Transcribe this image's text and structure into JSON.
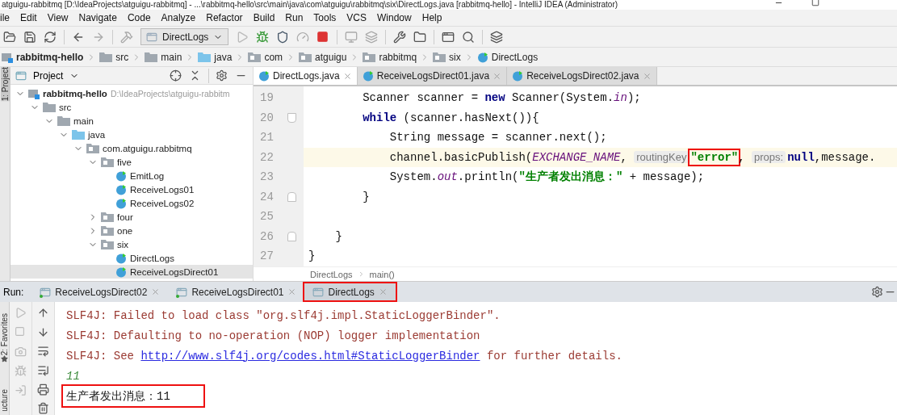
{
  "window": {
    "title": "atguigu-rabbitmq [D:\\IdeaProjects\\atguigu-rabbitmq] - ...\\rabbitmq-hello\\src\\main\\java\\com\\atguigu\\rabbitmq\\six\\DirectLogs.java [rabbitmq-hello] - IntelliJ IDEA (Administrator)"
  },
  "menu": [
    "ile",
    "Edit",
    "View",
    "Navigate",
    "Code",
    "Analyze",
    "Refactor",
    "Build",
    "Run",
    "Tools",
    "VCS",
    "Window",
    "Help"
  ],
  "toolbar": {
    "run_config": "DirectLogs"
  },
  "breadcrumb": [
    {
      "label": "rabbitmq-hello",
      "kind": "module"
    },
    {
      "label": "src",
      "kind": "folder"
    },
    {
      "label": "main",
      "kind": "folder"
    },
    {
      "label": "java",
      "kind": "source-folder"
    },
    {
      "label": "com",
      "kind": "package"
    },
    {
      "label": "atguigu",
      "kind": "package"
    },
    {
      "label": "rabbitmq",
      "kind": "package"
    },
    {
      "label": "six",
      "kind": "package"
    },
    {
      "label": "DirectLogs",
      "kind": "class"
    }
  ],
  "side_tabs": {
    "top": "1: Project",
    "favorites": "2: Favorites",
    "structure": "ucture"
  },
  "project": {
    "title": "Project",
    "tree": [
      {
        "label": "rabbitmq-hello",
        "path": "D:\\IdeaProjects\\atguigu-rabbitm",
        "kind": "module",
        "expanded": true,
        "selected": false,
        "children": [
          {
            "label": "src",
            "kind": "folder",
            "expanded": true,
            "selected": false,
            "children": [
              {
                "label": "main",
                "kind": "folder",
                "expanded": true,
                "selected": false,
                "children": [
                  {
                    "label": "java",
                    "kind": "source-folder",
                    "expanded": true,
                    "selected": false,
                    "children": [
                      {
                        "label": "com.atguigu.rabbitmq",
                        "kind": "package",
                        "expanded": true,
                        "selected": false,
                        "children": [
                          {
                            "label": "five",
                            "kind": "package",
                            "expanded": true,
                            "selected": false,
                            "children": [
                              {
                                "label": "EmitLog",
                                "kind": "class",
                                "selected": false
                              },
                              {
                                "label": "ReceiveLogs01",
                                "kind": "class",
                                "selected": false
                              },
                              {
                                "label": "ReceiveLogs02",
                                "kind": "class",
                                "selected": false
                              }
                            ]
                          },
                          {
                            "label": "four",
                            "kind": "package",
                            "expanded": false,
                            "selected": false
                          },
                          {
                            "label": "one",
                            "kind": "package",
                            "expanded": false,
                            "selected": false
                          },
                          {
                            "label": "six",
                            "kind": "package",
                            "expanded": true,
                            "selected": false,
                            "children": [
                              {
                                "label": "DirectLogs",
                                "kind": "class",
                                "selected": false
                              },
                              {
                                "label": "ReceiveLogsDirect01",
                                "kind": "class",
                                "selected": true
                              }
                            ]
                          }
                        ]
                      }
                    ]
                  }
                ]
              }
            ]
          }
        ]
      }
    ]
  },
  "editor": {
    "tabs": [
      {
        "label": "DirectLogs.java",
        "selected": true
      },
      {
        "label": "ReceiveLogsDirect01.java",
        "selected": false
      },
      {
        "label": "ReceiveLogsDirect02.java",
        "selected": false
      }
    ],
    "lines": [
      {
        "number": "19",
        "current": false,
        "tokens": [
          {
            "kind": "plain",
            "text": "        Scanner scanner = "
          },
          {
            "kind": "keyword",
            "text": "new"
          },
          {
            "kind": "plain",
            "text": " Scanner(System."
          },
          {
            "kind": "field",
            "text": "in"
          },
          {
            "kind": "plain",
            "text": ");"
          }
        ]
      },
      {
        "number": "20",
        "current": false,
        "fold_start": true,
        "tokens": [
          {
            "kind": "keyword",
            "text": "        while"
          },
          {
            "kind": "plain",
            "text": " (scanner.hasNext()){"
          }
        ]
      },
      {
        "number": "21",
        "current": false,
        "tokens": [
          {
            "kind": "plain",
            "text": "            String message = scanner.next();"
          }
        ]
      },
      {
        "number": "22",
        "current": true,
        "tokens": [
          {
            "kind": "plain",
            "text": "            channel.basicPublish("
          },
          {
            "kind": "field",
            "text": "EXCHANGE_NAME"
          },
          {
            "kind": "plain",
            "text": ", "
          },
          {
            "kind": "hint",
            "text": "routingKey"
          },
          {
            "kind": "string",
            "text": "\"error\"",
            "boxed": true
          },
          {
            "kind": "plain",
            "text": ", "
          },
          {
            "kind": "hint",
            "text": "props:"
          },
          {
            "kind": "keyword",
            "text": "null"
          },
          {
            "kind": "plain",
            "text": ",message."
          }
        ]
      },
      {
        "number": "23",
        "current": false,
        "tokens": [
          {
            "kind": "plain",
            "text": "            System."
          },
          {
            "kind": "field",
            "text": "out"
          },
          {
            "kind": "plain",
            "text": ".println("
          },
          {
            "kind": "string",
            "text": "\"生产者发出消息：\""
          },
          {
            "kind": "plain",
            "text": " + message);"
          }
        ]
      },
      {
        "number": "24",
        "current": false,
        "fold_end": true,
        "tokens": [
          {
            "kind": "plain",
            "text": "        }"
          }
        ]
      },
      {
        "number": "25",
        "current": false
      },
      {
        "number": "26",
        "current": false,
        "fold_end": true,
        "tokens": [
          {
            "kind": "plain",
            "text": "    }"
          }
        ]
      },
      {
        "number": "27",
        "current": false,
        "tokens": [
          {
            "kind": "plain",
            "text": "}"
          }
        ]
      }
    ],
    "crumbs": [
      "DirectLogs",
      "main()"
    ]
  },
  "run": {
    "label": "Run:",
    "tabs": [
      {
        "label": "ReceiveLogsDirect02",
        "selected": false,
        "running": true,
        "boxed": false
      },
      {
        "label": "ReceiveLogsDirect01",
        "selected": false,
        "running": true,
        "boxed": false
      },
      {
        "label": "DirectLogs",
        "selected": true,
        "running": false,
        "boxed": true
      }
    ],
    "console": [
      {
        "kind": "error",
        "boxed": false,
        "parts": [
          {
            "kind": "text",
            "text": "SLF4J: Failed to load class \"org.slf4j.impl.StaticLoggerBinder\"."
          }
        ]
      },
      {
        "kind": "error",
        "boxed": false,
        "parts": [
          {
            "kind": "text",
            "text": "SLF4J: Defaulting to no-operation (NOP) logger implementation"
          }
        ]
      },
      {
        "kind": "error",
        "boxed": false,
        "parts": [
          {
            "kind": "text",
            "text": "SLF4J: See "
          },
          {
            "kind": "link",
            "text": "http://www.slf4j.org/codes.html#StaticLoggerBinder"
          },
          {
            "kind": "text",
            "text": " for further details."
          }
        ]
      },
      {
        "kind": "input",
        "boxed": false,
        "parts": [
          {
            "kind": "text",
            "text": "11"
          }
        ]
      },
      {
        "kind": "output",
        "boxed": true,
        "parts": [
          {
            "kind": "text",
            "text": "生产者发出消息：11"
          }
        ]
      }
    ]
  }
}
